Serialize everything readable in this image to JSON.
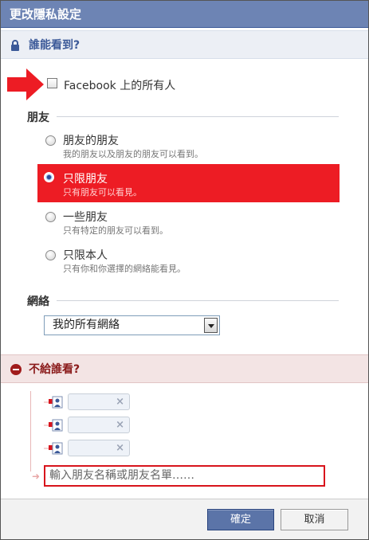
{
  "dialog": {
    "title": "更改隱私設定"
  },
  "who_can_see": {
    "heading": "誰能看到?",
    "icon": "lock-icon",
    "everyone_label": "Facebook 上的所有人",
    "everyone_checked": false
  },
  "friends": {
    "group_label": "朋友",
    "options": [
      {
        "title": "朋友的朋友",
        "subtitle": "我的朋友以及朋友的朋友可以看到。",
        "selected": false
      },
      {
        "title": "只限朋友",
        "subtitle": "只有朋友可以看見。",
        "selected": true
      },
      {
        "title": "一些朋友",
        "subtitle": "只有特定的朋友可以看到。",
        "selected": false
      },
      {
        "title": "只限本人",
        "subtitle": "只有你和你選擇的網絡能看見。",
        "selected": false
      }
    ]
  },
  "networks": {
    "group_label": "網絡",
    "select_value": "我的所有網絡"
  },
  "hide_from": {
    "heading": "不給誰看?",
    "icon": "minus-circle-icon",
    "name_input_placeholder": "輸入朋友名稱或朋友名單……",
    "token_remove_symbol": "×"
  },
  "footer": {
    "confirm_label": "確定",
    "cancel_label": "取消"
  },
  "colors": {
    "title_bar": "#6d84b4",
    "highlight": "#ed1c24",
    "confirm_button": "#5b74a8",
    "annotation_red": "#d8141c"
  }
}
